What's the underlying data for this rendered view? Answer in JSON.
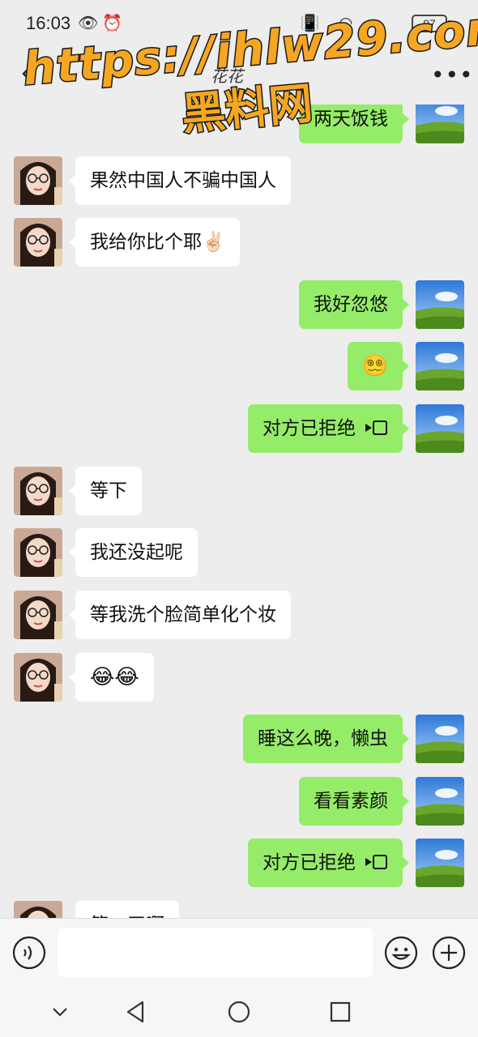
{
  "status_bar": {
    "time": "16:03",
    "battery": "97"
  },
  "header": {
    "title": "花花",
    "back_icon": "chevron-left-icon",
    "more_icon": "more-dots-icon"
  },
  "watermark": {
    "line1": "https://ihlw29.com",
    "line2": "黑料网"
  },
  "colors": {
    "sent_bubble": "#95ec69",
    "received_bubble": "#ffffff",
    "background": "#ededed",
    "watermark": "#f5a623"
  },
  "messages": [
    {
      "side": "right",
      "text": "两天饭钱"
    },
    {
      "side": "left",
      "text": "果然中国人不骗中国人"
    },
    {
      "side": "left",
      "text": "我给你比个耶✌🏻"
    },
    {
      "side": "right",
      "text": "我好忽悠"
    },
    {
      "side": "right",
      "text": "😵‍💫"
    },
    {
      "side": "right",
      "text": "对方已拒绝",
      "icon": "video-call-icon"
    },
    {
      "side": "left",
      "text": "等下"
    },
    {
      "side": "left",
      "text": "我还没起呢"
    },
    {
      "side": "left",
      "text": "等我洗个脸简单化个妆"
    },
    {
      "side": "left",
      "text": "😂😂"
    },
    {
      "side": "right",
      "text": "睡这么晚，懒虫"
    },
    {
      "side": "right",
      "text": "看看素颜"
    },
    {
      "side": "right",
      "text": "对方已拒绝",
      "icon": "video-call-icon"
    },
    {
      "side": "left",
      "text": "第一天啊"
    }
  ],
  "input_bar": {
    "placeholder": "",
    "voice_icon": "voice-icon",
    "emoji_icon": "emoji-icon",
    "plus_icon": "plus-icon"
  },
  "nav_bar": {
    "icons": [
      "chevron-down-icon",
      "back-triangle-icon",
      "home-circle-icon",
      "recent-square-icon"
    ]
  }
}
